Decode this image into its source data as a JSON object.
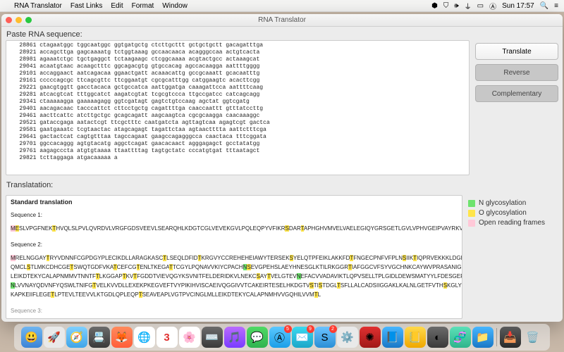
{
  "menubar": {
    "app": "RNA Translator",
    "items": [
      "Fast Links",
      "Edit",
      "Format",
      "Window"
    ],
    "right": {
      "time": "Sun 17:57"
    }
  },
  "window": {
    "title": "RNA Translator"
  },
  "labels": {
    "paste": "Paste RNA sequence:",
    "translation": "Translatation:"
  },
  "buttons": {
    "translate": "Translate",
    "reverse": "Reverse",
    "complementary": "Complementary"
  },
  "legend": {
    "n": "N glycosylation",
    "o": "O glycosylation",
    "orf": "Open reading frames"
  },
  "rna_rows": [
    {
      "n": "28861",
      "s": "ctagaatggc tggcaatggc ggtgatgctg ctcttgcttt gctgctgctt gacagatttga"
    },
    {
      "n": "28921",
      "s": "accagcttga gagcaaaatg tctggtaaag gccaacaaca acagggccaa actgtcacta"
    },
    {
      "n": "28981",
      "s": "agaaatctgc tgctgaggct tctaagaagc ctcggcaaaa acgtactgcc actaaagcat"
    },
    {
      "n": "29041",
      "s": "acaatgtaac acaagctttc ggcagacgtg gtgccacag agccacaagga aattttgggg"
    },
    {
      "n": "29101",
      "s": "accaggaact aatcagacaa ggaactgatt acaaacattg gccgcaaatt gcacaatttg"
    },
    {
      "n": "29161",
      "s": "cccccagcgc ttcagcgttc ttcggaatgt cgcgcatttgg catggaagtc acacttcgg"
    },
    {
      "n": "29221",
      "s": "gaacgtggtt gacctacaca gctgccatca aattggatga caaagattcca aattttcaag"
    },
    {
      "n": "29281",
      "s": "atcacgtcat tttggcatct aagatcgtat tcgcgtccca ttgccgatcc catcagcagg"
    },
    {
      "n": "29341",
      "s": "ctaaaaagga gaaaaagagg ggtcgatagt gagtctgtccaag agctat ggtcgatg"
    },
    {
      "n": "29401",
      "s": "aacagacaac tacccattct cttcctgctg cagattttga caaccaattt gtttatccttg"
    },
    {
      "n": "29461",
      "s": "aacttcattc atcttgctgc gcagcagatt aagcaagtca cgcgcaagga caacaaaggc"
    },
    {
      "n": "29521",
      "s": "gataccgaga aatactcgt ttcgctttc caatgatcta agttagtcaa agagtcgt gactca"
    },
    {
      "n": "29581",
      "s": "gaatgaaatc tcgtaactac atagcagagt tagattctaa agtaactttta aattctttcga"
    },
    {
      "n": "29641",
      "s": "gactactcat cagtgtttaa tagccagaat gaagccagagggcca caactaca tttcggata"
    },
    {
      "n": "29701",
      "s": "ggccacaggg agtgtacatg aggctcagat gaacacaact agggagagct gcctatatgg"
    },
    {
      "n": "29761",
      "s": "aagagcccta atgtgtaaaa ttaattttag tagtgctatc cccatgtgat tttaatagct"
    },
    {
      "n": "29821",
      "s": "tcttaggaga atgacaaaaa a"
    }
  ],
  "translation": {
    "heading": "Standard translation",
    "seq1_label": "Sequence 1:",
    "seq2_label": "Sequence 2:",
    "seq3_label": "Sequence 3:",
    "seq1": "MESLVPGFNEKTHVQLSLPVLQVRDVLVRGFGDSVEEVLSEARQHLKDGTCGLVEVEKGVLPQLEQPYVFIKRSDARTAPHGHVMVELVAELEGIQYGRSGETLGVLVPHVGEIPVAYRKVLLRKNGNKGAGGHSYGADLKSFDLGDELGTDPYEDFQENWNTKH",
    "seq2_line1": "MRELNGGAYTRYVDNNFCGPDGYPLECIKDLLARAGKASCTLSEQLDFIDTKRGVYCCREHEHEIAWYTERSEKSYELQTPFEIKLAKKFDTFNGECPNFVFPLNSIIKTIQPRVEKKKLDGFMGRIRSVYPVASPNECN",
    "seq2_line2": "QMCLSTLMKCDHCGETSWQTGDFVKATCEFCGTENLTKEGATTCGYLPQNAVVKIYCPACHNSEVGPEHSLAEYHNESGLKTILRKGGRTIAFGGCVFSYVGCHNKCAYWVPRASANIGCNHTGVVGEGSEGLNDNL",
    "seq2_line3": "LEIKDTEKYCALAPNMMVTNNTFTLKGGAPTKVTFGDDTVIEVQGYKSVNITFELDERIDKVLNEKCSAYTVELGTEVNEFACVVADAVIKTLQPVSELLTPLGIDLDEWSMATYYLFDESGEFKLASHMYCSFYPPDED",
    "seq2_line4": "NLVVNAYQDVNFYQSWLTNIFGTVELKVVDLLEXEKPKEGVEFTVYPIKIHVISCAEIVQGGIVVTCAKEIRTESELHKDGTVSTISTDGLTSFLLALCADSIIGGAKLKALNLGETFVTHSKGLYRKCVKSRVEVGNTTSGLLMPL",
    "seq2_line5": "KAPKEIIFLEGETLPTEVLTEEVVLKTGDLQPLEQPTSEAVEAPLVGTPVCINGLMLLEIKDTEKYCALAPNMHVVGQHILVVMTL"
  }
}
